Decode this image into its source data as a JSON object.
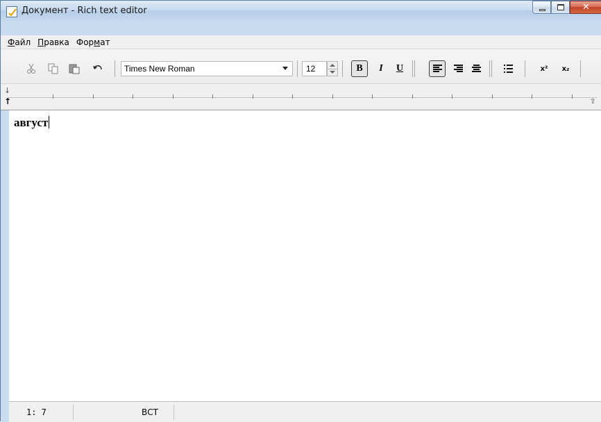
{
  "window": {
    "title": "Документ - Rich text editor"
  },
  "menu": {
    "items": [
      {
        "label": "Файл",
        "mnemonic": "Ф",
        "rest": "айл"
      },
      {
        "label": "Правка",
        "mnemonic": "П",
        "rest": "равка"
      },
      {
        "label": "Формат",
        "prefix": "Фор",
        "mnemonic": "м",
        "rest": "ат"
      }
    ]
  },
  "toolbar": {
    "font_name": "Times New Roman",
    "font_size": "12",
    "bold_label": "B",
    "italic_label": "I",
    "underline_label": "U",
    "superscript_label": "x²",
    "subscript_label": "x₂"
  },
  "editor": {
    "text": "август"
  },
  "status": {
    "position": "1: 7",
    "mode": "ВСТ"
  },
  "colors": {
    "window_frame": "#c9dcef",
    "close_button": "#c2442a"
  },
  "icons": [
    "cut-icon",
    "copy-icon",
    "paste-icon",
    "undo-icon",
    "align-left-icon",
    "align-right-icon",
    "align-center-icon",
    "bullet-list-icon"
  ]
}
